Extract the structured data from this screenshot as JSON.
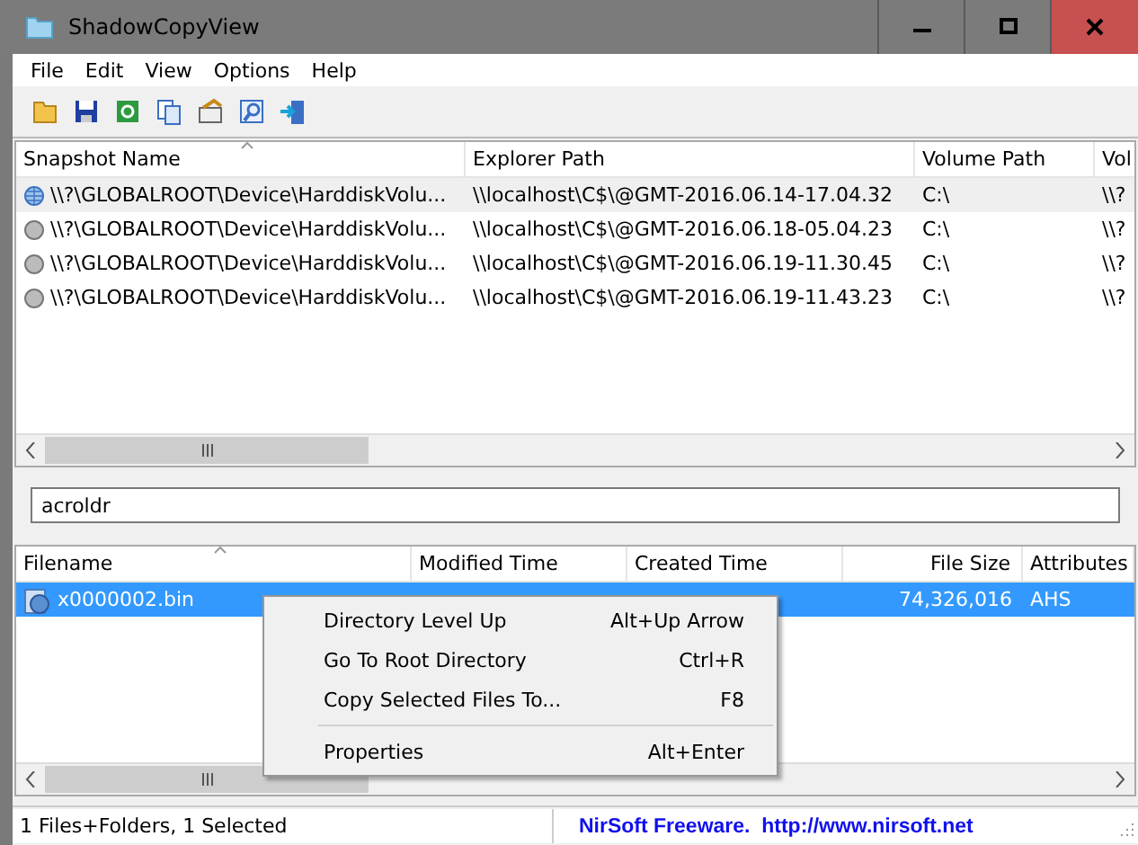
{
  "window": {
    "title": "ShadowCopyView"
  },
  "menu_bar": [
    "File",
    "Edit",
    "View",
    "Options",
    "Help"
  ],
  "snapshots": {
    "columns": [
      {
        "label": "Snapshot Name",
        "sorted": true
      },
      {
        "label": "Explorer Path",
        "sorted": false
      },
      {
        "label": "Volume Path",
        "sorted": false
      },
      {
        "label": "Vol",
        "sorted": false
      }
    ],
    "rows": [
      {
        "selected": true,
        "cells": [
          "\\\\?\\GLOBALROOT\\Device\\HarddiskVolu...",
          "\\\\localhost\\C$\\@GMT-2016.06.14-17.04.32",
          "C:\\",
          "\\\\?"
        ]
      },
      {
        "selected": false,
        "cells": [
          "\\\\?\\GLOBALROOT\\Device\\HarddiskVolu...",
          "\\\\localhost\\C$\\@GMT-2016.06.18-05.04.23",
          "C:\\",
          "\\\\?"
        ]
      },
      {
        "selected": false,
        "cells": [
          "\\\\?\\GLOBALROOT\\Device\\HarddiskVolu...",
          "\\\\localhost\\C$\\@GMT-2016.06.19-11.30.45",
          "C:\\",
          "\\\\?"
        ]
      },
      {
        "selected": false,
        "cells": [
          "\\\\?\\GLOBALROOT\\Device\\HarddiskVolu...",
          "\\\\localhost\\C$\\@GMT-2016.06.19-11.43.23",
          "C:\\",
          "\\\\?"
        ]
      }
    ]
  },
  "filter": {
    "value": "acroldr"
  },
  "files": {
    "columns": [
      {
        "label": "Filename",
        "sorted": true
      },
      {
        "label": "Modified Time",
        "sorted": false
      },
      {
        "label": "Created Time",
        "sorted": false
      },
      {
        "label": "File Size",
        "sorted": false
      },
      {
        "label": "Attributes",
        "sorted": false
      }
    ],
    "rows": [
      {
        "selected": true,
        "cells": [
          "x0000002.bin",
          "",
          "",
          "74,326,016",
          "AHS"
        ]
      }
    ]
  },
  "context_menu": [
    {
      "kind": "item",
      "label": "Directory Level Up",
      "shortcut": "Alt+Up Arrow"
    },
    {
      "kind": "item",
      "label": "Go To Root Directory",
      "shortcut": "Ctrl+R"
    },
    {
      "kind": "item",
      "label": "Copy Selected Files To...",
      "shortcut": "F8"
    },
    {
      "kind": "separator"
    },
    {
      "kind": "item",
      "label": "Properties",
      "shortcut": "Alt+Enter"
    }
  ],
  "status_bar": {
    "text": "1 Files+Folders, 1 Selected",
    "link": "NirSoft Freeware.  http://www.nirsoft.net"
  }
}
